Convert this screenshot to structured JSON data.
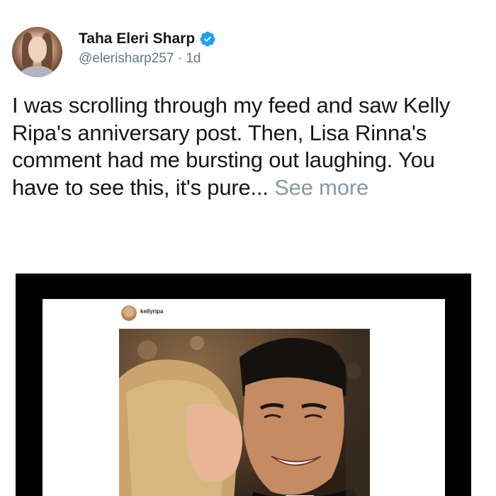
{
  "tweet": {
    "display_name": "Taha Eleri Sharp",
    "handle": "@elerisharp257",
    "separator": "·",
    "time": "1d",
    "verified_icon": "verified-badge-icon",
    "text": "I was scrolling through my feed and saw Kelly Ripa's anniversary post. Then, Lisa Rinna's comment had me bursting out laughing. You have to see this, it's pure...",
    "see_more": "See more"
  },
  "media": {
    "instagram_username": "kellyripa"
  },
  "colors": {
    "text": "#14171a",
    "secondary": "#657786",
    "see_more": "#8899a6",
    "verified": "#1da1f2",
    "media_frame": "#000000"
  }
}
